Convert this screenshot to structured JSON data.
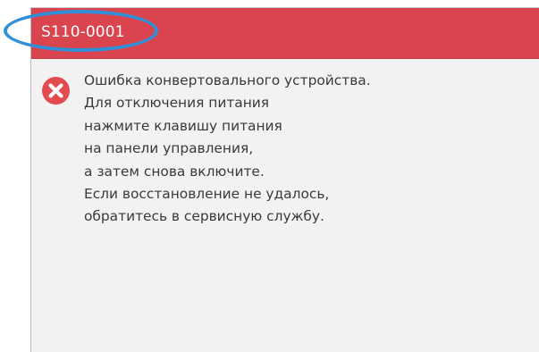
{
  "dialog": {
    "error_code": "S110-0001",
    "header_color": "#d9444f",
    "highlight_color": "#2f90d8",
    "icon": "error-x-icon",
    "message_lines": [
      "Ошибка конвертовального устройства.",
      "Для отключения питания",
      "нажмите клавишу питания",
      "на панели управления,",
      "а затем снова включите.",
      "Если восстановление не удалось,",
      "обратитесь в сервисную службу."
    ]
  }
}
